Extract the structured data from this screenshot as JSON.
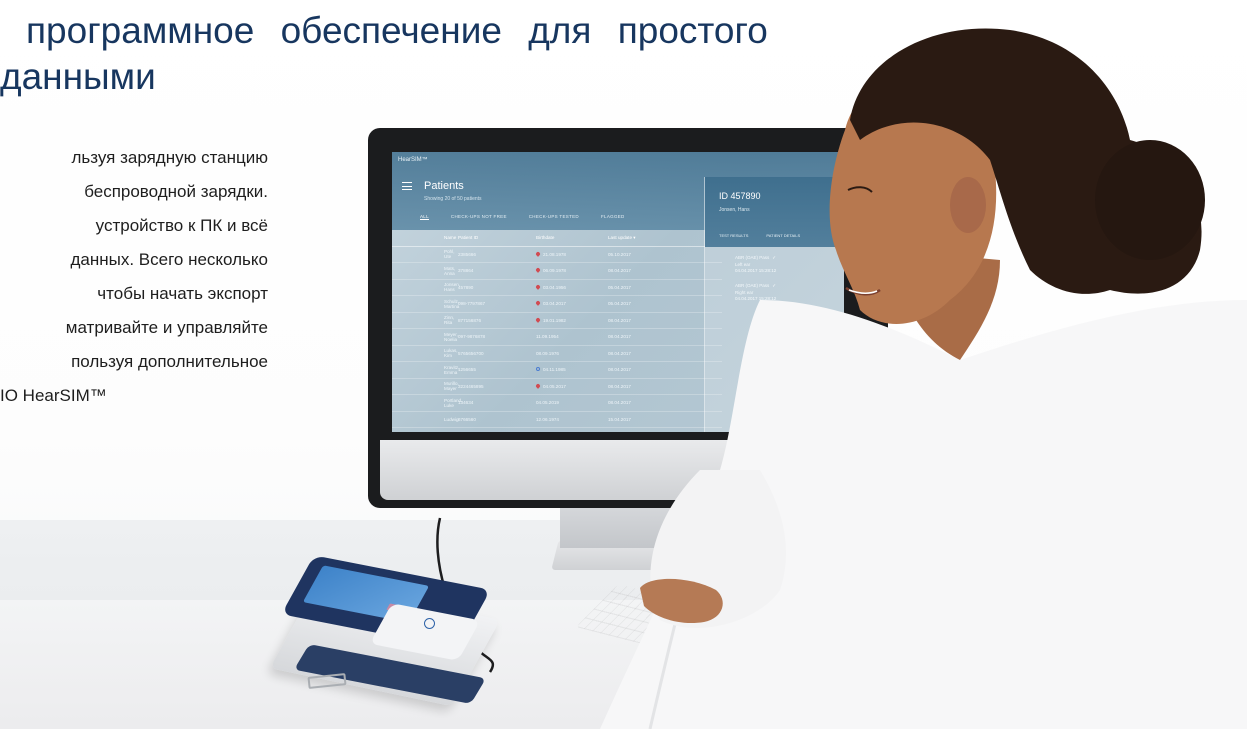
{
  "headline": {
    "line1": "программное обеспечение для простого",
    "line2": "данными"
  },
  "paragraph": {
    "lines": [
      "льзуя зарядную станцию",
      "беспроводной зарядки.",
      "устройство к ПК и всё",
      "данных. Всего несколько",
      "чтобы начать экспорт",
      "матривайте и управляйте",
      "пользуя дополнительное",
      "IO HearSIM™"
    ]
  },
  "app": {
    "brand": "HearSIM™",
    "title": "Patients",
    "subtitle": "Showing 20 of 50 patients",
    "tabs": [
      "ALL",
      "CHECK-UPS NOT FREE",
      "CHECK-UPS TESTED",
      "FLAGGED"
    ],
    "columns": [
      "Name",
      "Patient ID",
      "Birthdate",
      "Last update ▾"
    ],
    "rows": [
      {
        "name": "Pohl, Ute",
        "id": "2385666",
        "birth": "21.08.1978",
        "update": "05.10.2017",
        "flag": "pin"
      },
      {
        "name": "Mats, Anna",
        "id": "378864",
        "birth": "06.09.1978",
        "update": "08.04.2017",
        "flag": "pin"
      },
      {
        "name": "Jonsen, Hans",
        "id": "457890",
        "birth": "03.04.1956",
        "update": "05.04.2017",
        "flag": "pin"
      },
      {
        "name": "Schulz, Martina",
        "id": "098-7797867",
        "birth": "03.04.2017",
        "update": "05.04.2017",
        "flag": "pin"
      },
      {
        "name": "Zinn, Rita",
        "id": "877156876",
        "birth": "19.01.1982",
        "update": "08.04.2017",
        "flag": "pin"
      },
      {
        "name": "Meyer, Noelia",
        "id": "097-9876878",
        "birth": "11.09.1954",
        "update": "08.04.2017",
        "flag": ""
      },
      {
        "name": "Lukas, Kim",
        "id": "5765656700",
        "birth": "08.09.1976",
        "update": "08.04.2017",
        "flag": ""
      },
      {
        "name": "Kravitz, Emma",
        "id": "1256655",
        "birth": "04.11.1985",
        "update": "08.04.2017",
        "flag": "male"
      },
      {
        "name": "Murillo, Mayer",
        "id": "3224465895",
        "birth": "04.05.2017",
        "update": "08.04.2017",
        "flag": "pin"
      },
      {
        "name": "Portland, Luke",
        "id": "134634",
        "birth": "04.05.2019",
        "update": "08.04.2017",
        "flag": ""
      },
      {
        "name": "Ludwig",
        "id": "6766560",
        "birth": "12.06.1974",
        "update": "15.04.2017",
        "flag": ""
      }
    ],
    "panel": {
      "id": "ID 457890",
      "name": "Jonsen, Hans",
      "tabs": [
        "TEST RESULTS",
        "PATIENT DETAILS"
      ],
      "items": [
        {
          "title": "ABR (OAE) Pass",
          "detail": "Left ear",
          "date": "04.04.2017 15:28:12"
        },
        {
          "title": "ABR (OAE) Pass",
          "detail": "Right ear",
          "date": "04.04.2017 15:28:12"
        }
      ]
    }
  }
}
